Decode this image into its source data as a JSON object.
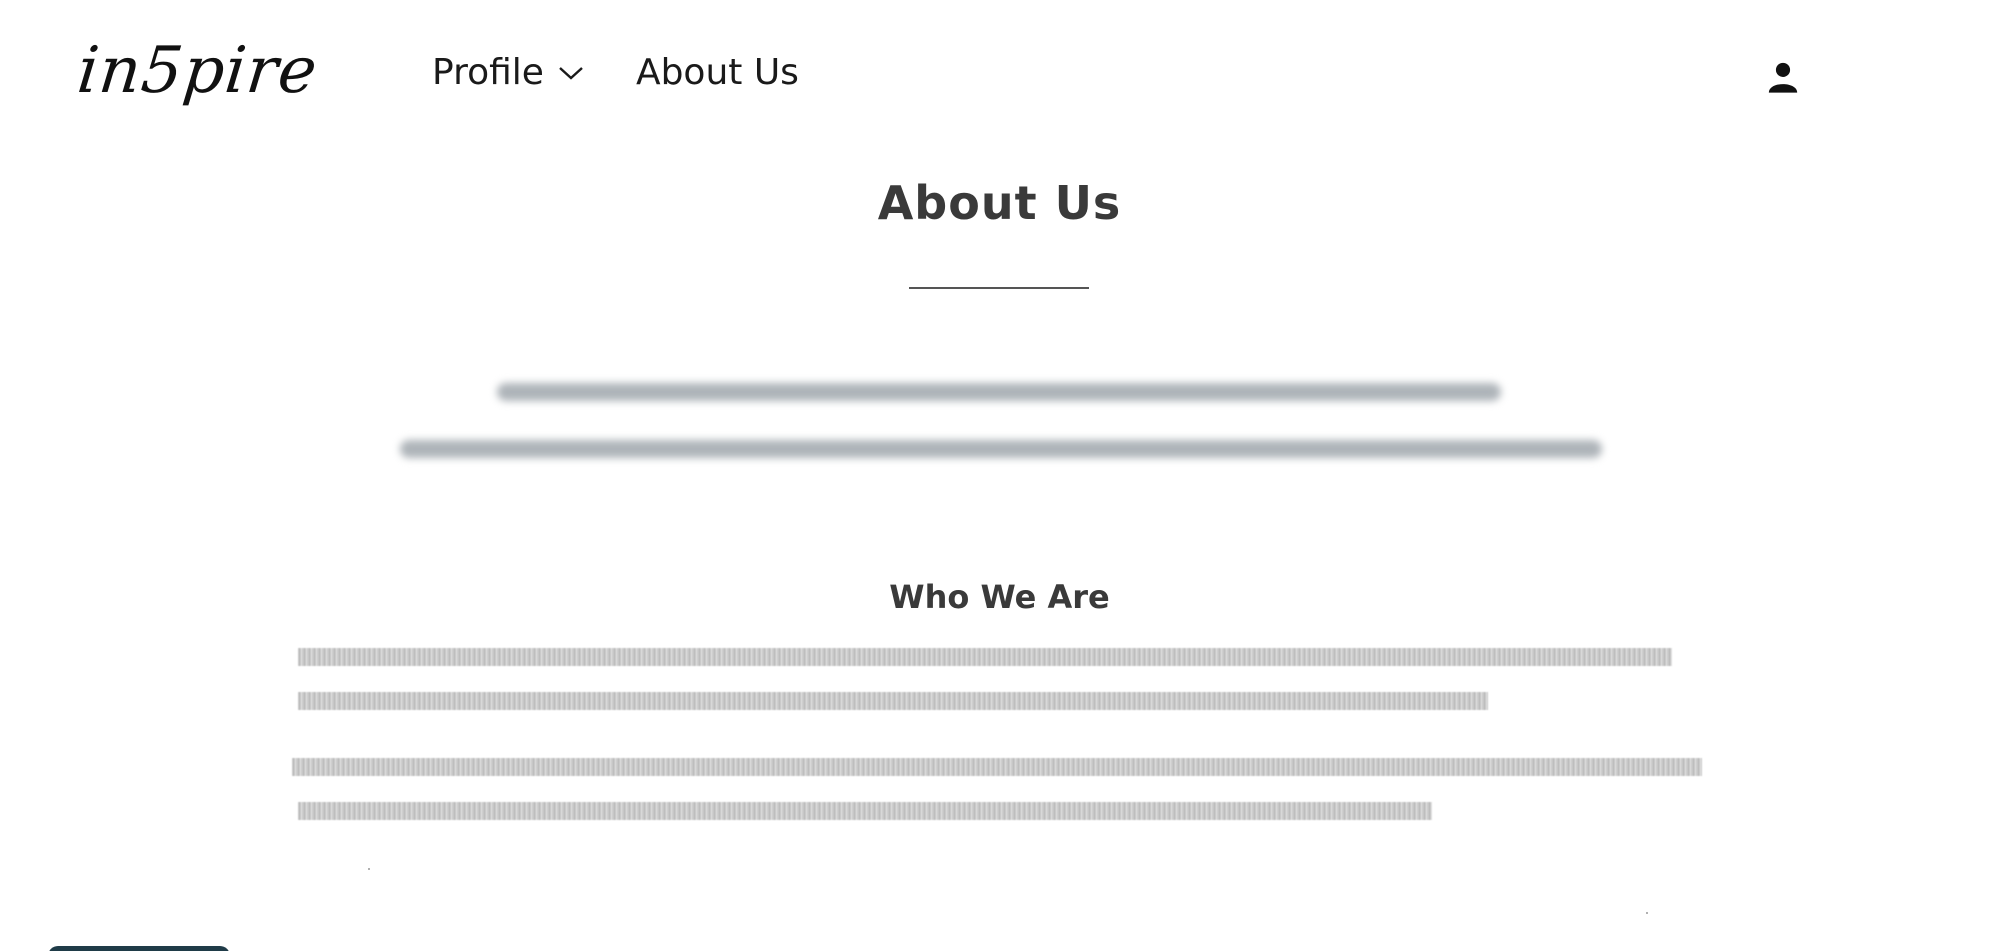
{
  "header": {
    "logo_text": "in5pire",
    "nav": [
      {
        "label": "Profile",
        "has_dropdown": true
      },
      {
        "label": "About Us",
        "has_dropdown": false
      }
    ],
    "account_icon": "person-icon"
  },
  "main": {
    "title": "About Us",
    "intro_lines": [
      "",
      ""
    ],
    "section_title": "Who We Are",
    "paragraph_1_lines": [
      "",
      ""
    ],
    "paragraph_2_lines": [
      "",
      ""
    ]
  },
  "colors": {
    "accent": "#1f3b48",
    "text": "#3a3a3a"
  }
}
